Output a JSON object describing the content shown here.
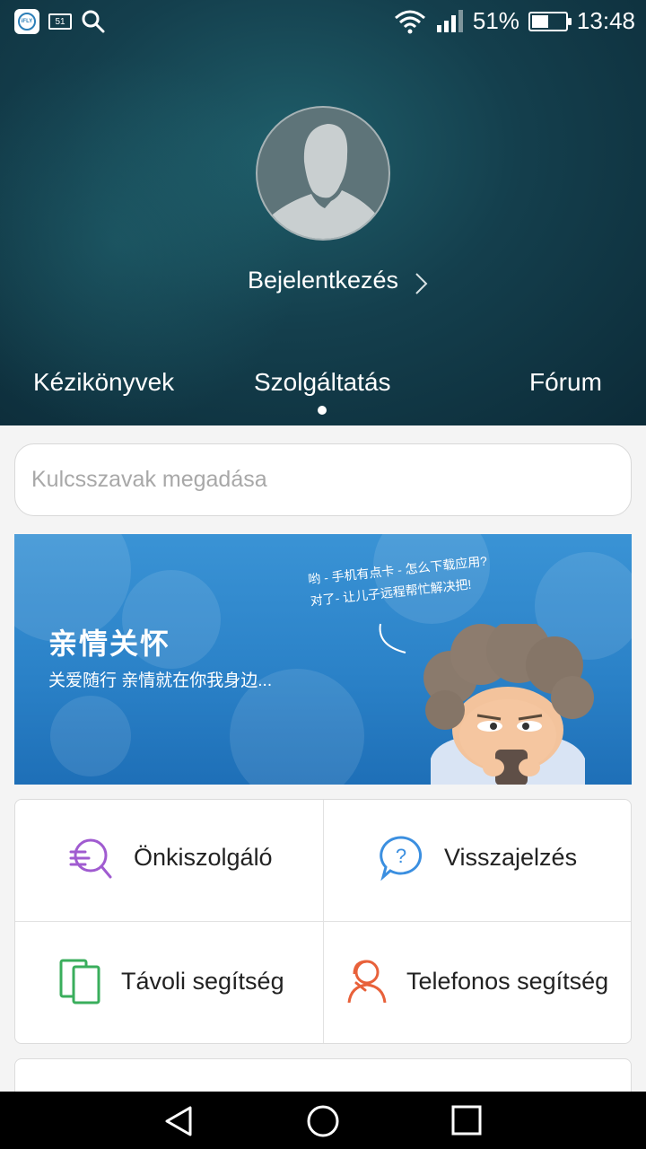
{
  "status_bar": {
    "app_icons": [
      "ifly-icon",
      "notification-51-icon",
      "search-icon"
    ],
    "ifly_label": "iFLY",
    "badge_number": "51",
    "battery_percent": "51%",
    "battery_level": 0.51,
    "time": "13:48"
  },
  "header": {
    "login_label": "Bejelentkezés",
    "tabs": [
      {
        "label": "Kézikönyvek"
      },
      {
        "label": "Szolgáltatás",
        "active": true
      },
      {
        "label": "Fórum"
      }
    ]
  },
  "search": {
    "placeholder": "Kulcsszavak megadása",
    "value": ""
  },
  "banner": {
    "title": "亲情关怀",
    "subtitle": "关爱随行 亲情就在你我身边...",
    "bubble_line1": "哟 - 手机有点卡 - 怎么下载应用?",
    "bubble_line2": "对了- 让儿子远程帮忙解决把!"
  },
  "services": [
    {
      "label": "Önkiszolgáló",
      "icon": "self-service-icon",
      "color": "#a05bd0"
    },
    {
      "label": "Visszajelzés",
      "icon": "question-bubble-icon",
      "color": "#3b8fe0"
    },
    {
      "label": "Távoli segítség",
      "icon": "remote-devices-icon",
      "color": "#3aae5c"
    },
    {
      "label": "Telefonos segítség",
      "icon": "phone-support-icon",
      "color": "#e8613a"
    }
  ],
  "nav": {
    "icons": [
      "back-icon",
      "home-icon",
      "recents-icon"
    ]
  }
}
